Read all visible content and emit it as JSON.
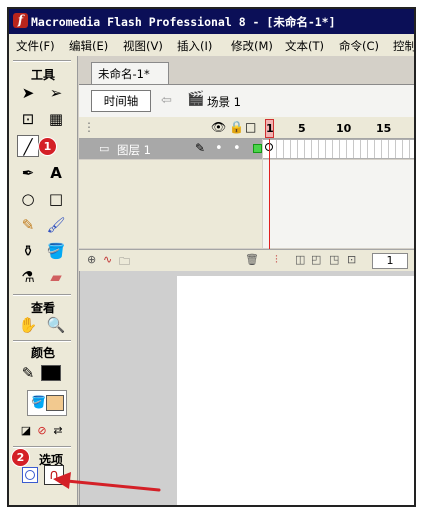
{
  "window": {
    "title": "Macromedia Flash Professional 8 - [未命名-1*]"
  },
  "menu": {
    "items": [
      "文件(F)",
      "编辑(E)",
      "视图(V)",
      "插入(I)",
      "修改(M)",
      "文本(T)",
      "命令(C)",
      "控制"
    ]
  },
  "toolbox": {
    "tools_title": "工具",
    "view_title": "查看",
    "colors_title": "颜色",
    "options_title": "选项",
    "badge1": "1",
    "badge2": "2",
    "text_tool": "A",
    "stroke_color": "#000000",
    "fill_color": "#f2c98f",
    "accent_red": "#d42027"
  },
  "document": {
    "tab_title": "未命名-1*",
    "timeline_button": "时间轴",
    "scene_label": "场景 1"
  },
  "timeline": {
    "frame_numbers": [
      "1",
      "5",
      "10",
      "15"
    ],
    "layer_name": "图层 1",
    "current_frame": "1"
  }
}
